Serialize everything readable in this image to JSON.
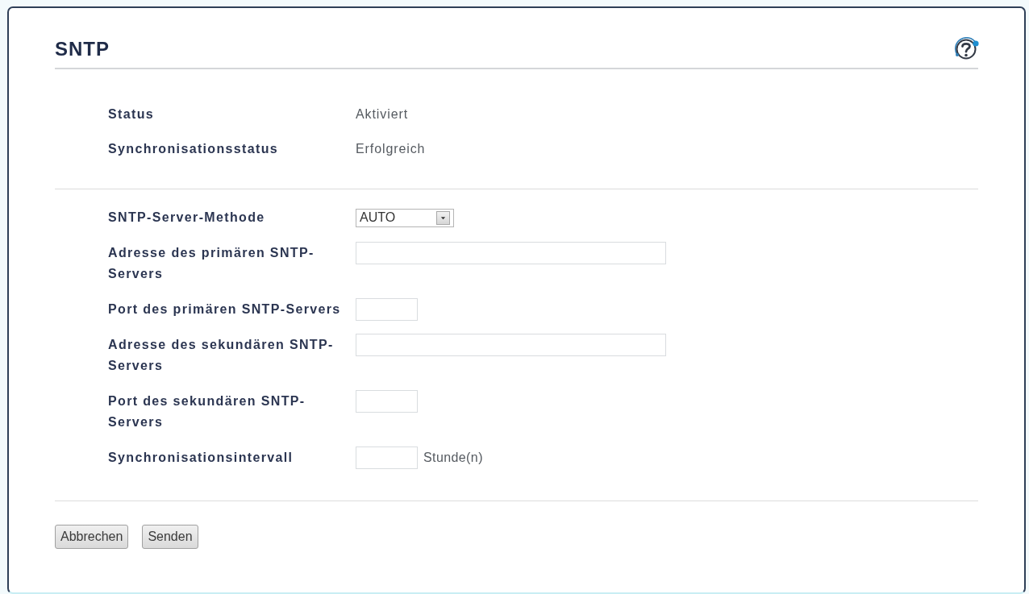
{
  "header": {
    "title": "SNTP"
  },
  "status": [
    {
      "label": "Status",
      "value": "Aktiviert"
    },
    {
      "label": "Synchronisationsstatus",
      "value": "Erfolgreich"
    }
  ],
  "fields": [
    {
      "kind": "dropdown",
      "label": "SNTP-Server-Methode",
      "value": "AUTO"
    },
    {
      "kind": "long",
      "label": "Adresse des primären SNTP-Servers"
    },
    {
      "kind": "short",
      "label": "Port des primären SNTP-Servers"
    },
    {
      "kind": "long",
      "label": "Adresse des sekundären SNTP-Servers"
    },
    {
      "kind": "short",
      "label": "Port des sekundären SNTP-Servers"
    },
    {
      "kind": "short",
      "label": "Synchronisationsintervall",
      "unit": "Stunde(n)"
    }
  ],
  "buttons": [
    "Abbrechen",
    "Senden"
  ]
}
